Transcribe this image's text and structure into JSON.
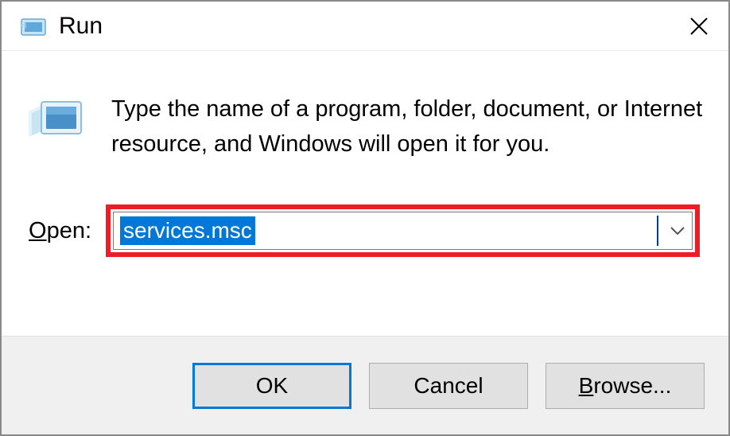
{
  "titlebar": {
    "title": "Run"
  },
  "content": {
    "description": "Type the name of a program, folder, document, or Internet resource, and Windows will open it for you.",
    "open_label_prefix": "O",
    "open_label_rest": "pen:",
    "input_value": "services.msc"
  },
  "buttons": {
    "ok": "OK",
    "cancel": "Cancel",
    "browse_prefix": "B",
    "browse_rest": "rowse..."
  }
}
